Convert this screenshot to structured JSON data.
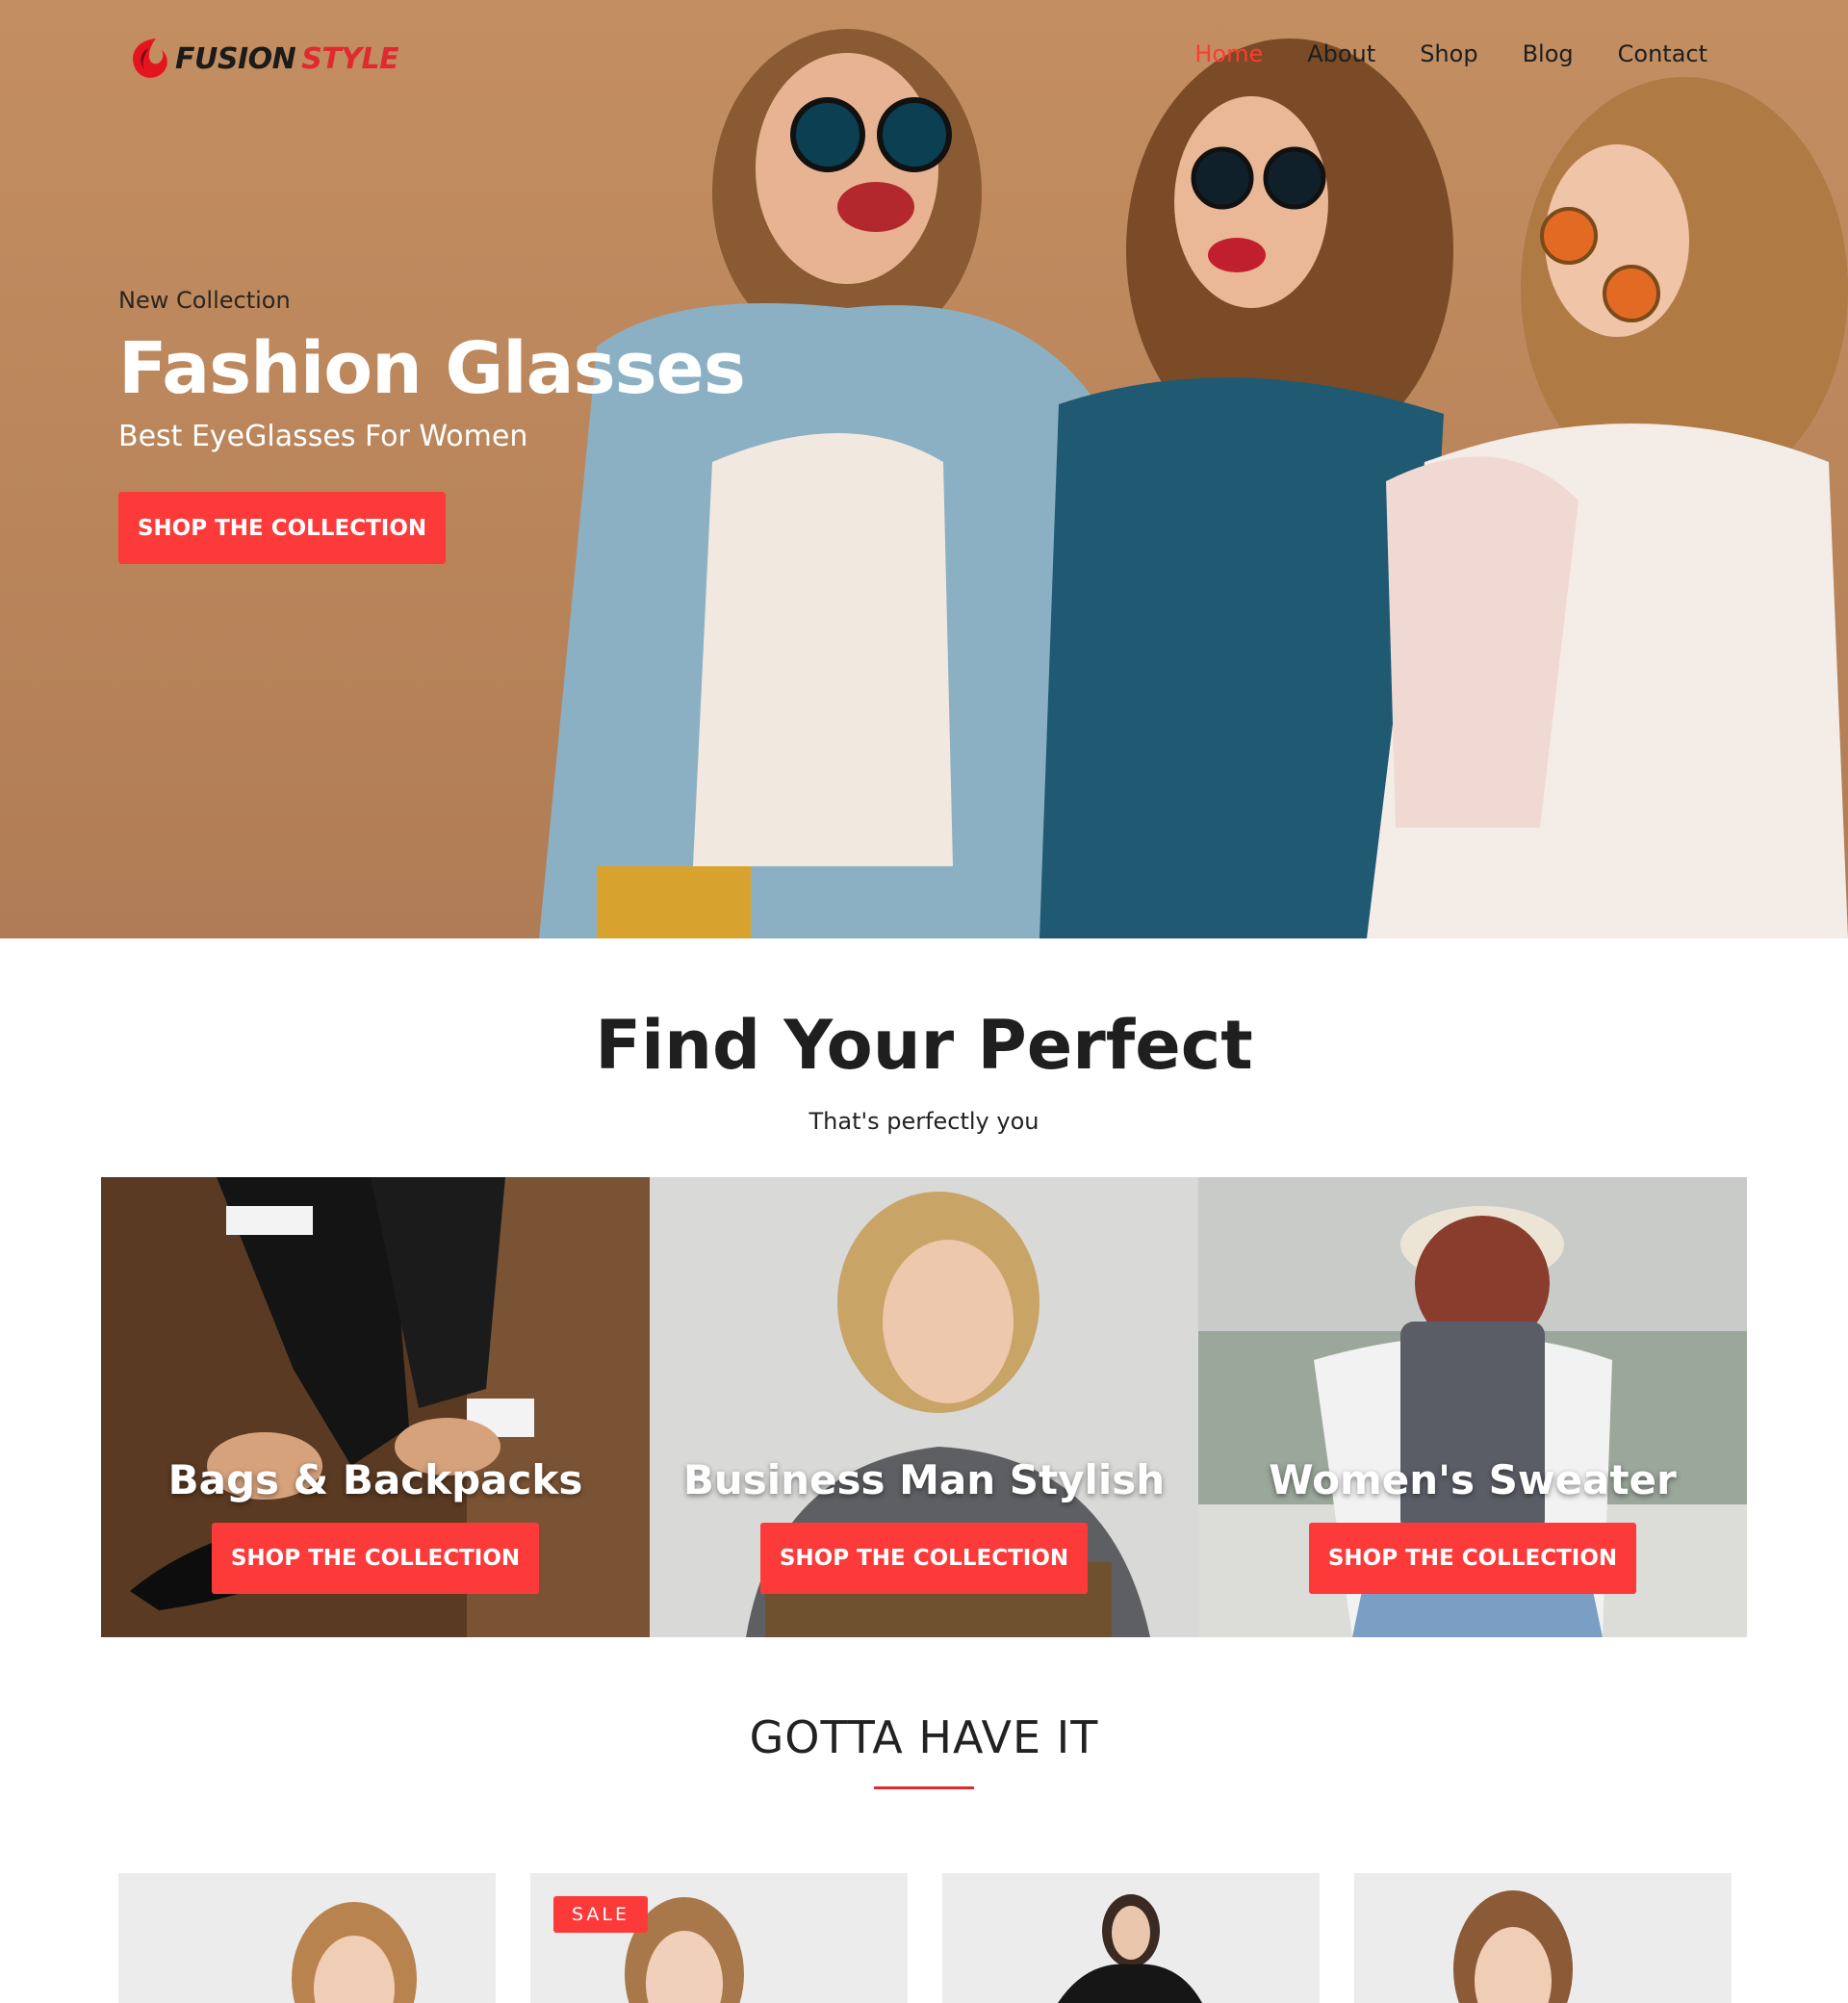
{
  "brand": {
    "logo_word1": "FUSION",
    "logo_word2": "STYLE"
  },
  "nav": {
    "items": [
      "Home",
      "About",
      "Shop",
      "Blog",
      "Contact"
    ],
    "active": "Home"
  },
  "hero": {
    "kicker": "New Collection",
    "title": "Fashion Glasses",
    "subtitle": "Best EyeGlasses For Women",
    "button": "SHOP THE COLLECTION"
  },
  "find": {
    "title": "Find Your Perfect",
    "subtitle": "That's perfectly you"
  },
  "categories": [
    {
      "label": "Bags & Backpacks",
      "button": "SHOP THE COLLECTION"
    },
    {
      "label": "Business Man Stylish",
      "button": "SHOP THE COLLECTION"
    },
    {
      "label": "Women's Sweater",
      "button": "SHOP THE COLLECTION"
    }
  ],
  "gotta": {
    "title": "GOTTA HAVE IT"
  },
  "products": [
    {
      "badge": ""
    },
    {
      "badge": "SALE"
    },
    {
      "badge": ""
    },
    {
      "badge": ""
    }
  ],
  "colors": {
    "accent": "#fd3a3a",
    "hero_bg": "#be8a5d",
    "text_dark": "#1f1f1f"
  },
  "icons": {
    "logo": "flame-logo-icon"
  }
}
